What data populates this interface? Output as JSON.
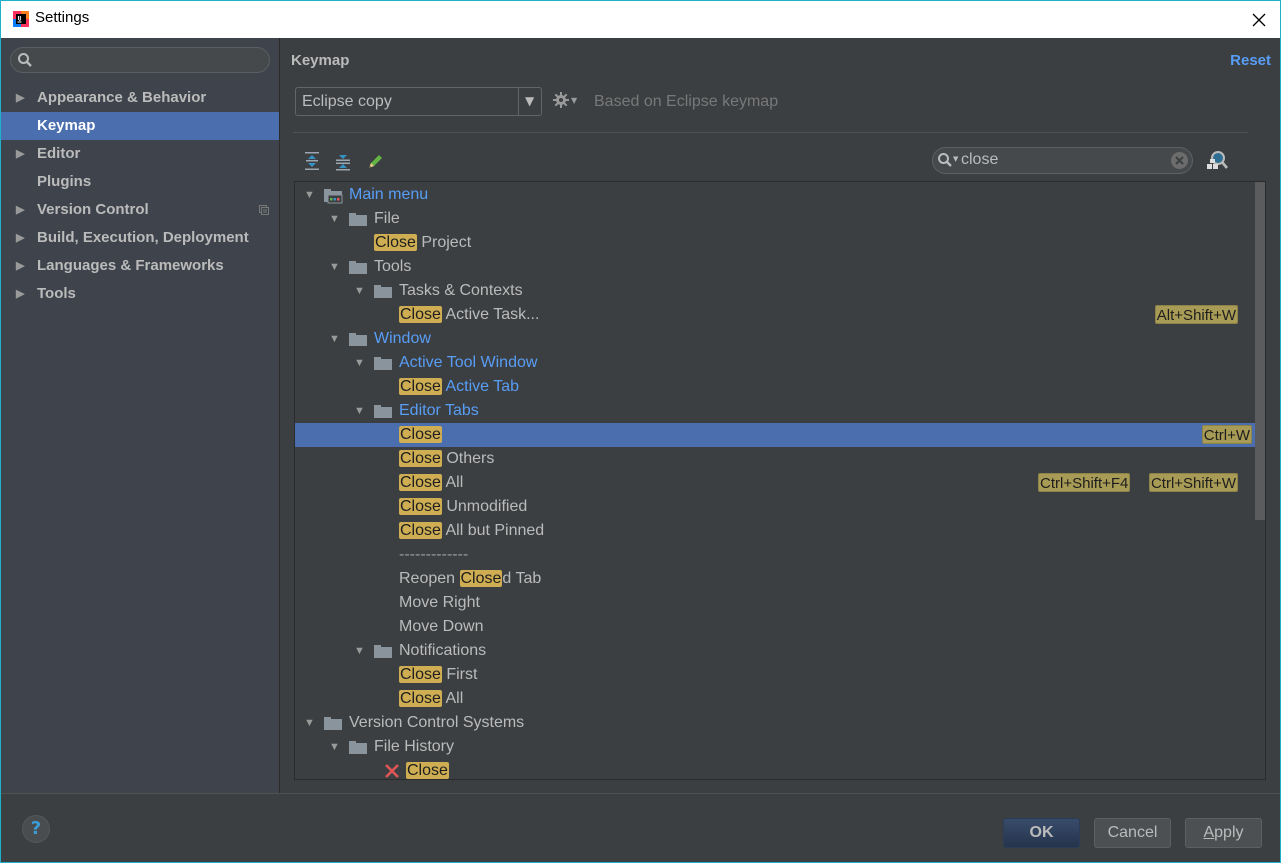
{
  "window": {
    "title": "Settings"
  },
  "sidebar": {
    "search_placeholder": "",
    "items": [
      {
        "label": "Appearance & Behavior",
        "expandable": true,
        "selected": false
      },
      {
        "label": "Keymap",
        "expandable": false,
        "selected": true
      },
      {
        "label": "Editor",
        "expandable": true,
        "selected": false
      },
      {
        "label": "Plugins",
        "expandable": false,
        "selected": false
      },
      {
        "label": "Version Control",
        "expandable": true,
        "selected": false,
        "project_icon": true
      },
      {
        "label": "Build, Execution, Deployment",
        "expandable": true,
        "selected": false
      },
      {
        "label": "Languages & Frameworks",
        "expandable": true,
        "selected": false
      },
      {
        "label": "Tools",
        "expandable": true,
        "selected": false
      }
    ]
  },
  "header": {
    "title": "Keymap",
    "reset_label": "Reset"
  },
  "keymap": {
    "selected": "Eclipse copy",
    "based_on": "Based on Eclipse keymap"
  },
  "toolbar": {
    "expand_all": "Expand All",
    "collapse_all": "Collapse All",
    "edit": "Edit Shortcut"
  },
  "filter": {
    "value": "close",
    "highlight": "Close"
  },
  "tree": {
    "rows": [
      {
        "level": 0,
        "type": "root",
        "expanded": true,
        "pre": "",
        "hl": "",
        "post": "Main menu",
        "blue": true,
        "shortcuts": []
      },
      {
        "level": 1,
        "type": "folder",
        "expanded": true,
        "pre": "",
        "hl": "",
        "post": "File",
        "blue": false,
        "shortcuts": []
      },
      {
        "level": 2,
        "type": "action",
        "pre": "",
        "hl": "Close",
        "post": " Project",
        "blue": false,
        "shortcuts": []
      },
      {
        "level": 1,
        "type": "folder",
        "expanded": true,
        "pre": "",
        "hl": "",
        "post": "Tools",
        "blue": false,
        "shortcuts": []
      },
      {
        "level": 2,
        "type": "folder",
        "expanded": true,
        "pre": "",
        "hl": "",
        "post": "Tasks & Contexts",
        "blue": false,
        "shortcuts": []
      },
      {
        "level": 3,
        "type": "action",
        "pre": "",
        "hl": "Close",
        "post": " Active Task...",
        "blue": false,
        "shortcuts": [
          "Alt+Shift+W"
        ]
      },
      {
        "level": 1,
        "type": "folder",
        "expanded": true,
        "pre": "",
        "hl": "",
        "post": "Window",
        "blue": true,
        "shortcuts": []
      },
      {
        "level": 2,
        "type": "folder",
        "expanded": true,
        "pre": "",
        "hl": "",
        "post": "Active Tool Window",
        "blue": true,
        "shortcuts": []
      },
      {
        "level": 3,
        "type": "action",
        "pre": "",
        "hl": "Close",
        "post": " Active Tab",
        "blue": true,
        "shortcuts": []
      },
      {
        "level": 2,
        "type": "folder",
        "expanded": true,
        "pre": "",
        "hl": "",
        "post": "Editor Tabs",
        "blue": true,
        "shortcuts": []
      },
      {
        "level": 3,
        "type": "action",
        "pre": "",
        "hl": "Close",
        "post": "",
        "blue": false,
        "selected": true,
        "shortcuts": [
          "Ctrl+W"
        ]
      },
      {
        "level": 3,
        "type": "action",
        "pre": "",
        "hl": "Close",
        "post": " Others",
        "blue": false,
        "shortcuts": []
      },
      {
        "level": 3,
        "type": "action",
        "pre": "",
        "hl": "Close",
        "post": " All",
        "blue": false,
        "shortcuts": [
          "Ctrl+Shift+F4",
          "Ctrl+Shift+W"
        ]
      },
      {
        "level": 3,
        "type": "action",
        "pre": "",
        "hl": "Close",
        "post": " Unmodified",
        "blue": false,
        "shortcuts": []
      },
      {
        "level": 3,
        "type": "action",
        "pre": "",
        "hl": "Close",
        "post": " All but Pinned",
        "blue": false,
        "shortcuts": []
      },
      {
        "level": 3,
        "type": "separator",
        "pre": "",
        "hl": "",
        "post": "-------------",
        "blue": false,
        "shortcuts": []
      },
      {
        "level": 3,
        "type": "action",
        "pre": "Reopen ",
        "hl": "Close",
        "post": "d Tab",
        "blue": false,
        "shortcuts": []
      },
      {
        "level": 3,
        "type": "action",
        "pre": "",
        "hl": "",
        "post": "Move Right",
        "blue": false,
        "shortcuts": []
      },
      {
        "level": 3,
        "type": "action",
        "pre": "",
        "hl": "",
        "post": "Move Down",
        "blue": false,
        "shortcuts": []
      },
      {
        "level": 2,
        "type": "folder",
        "expanded": true,
        "pre": "",
        "hl": "",
        "post": "Notifications",
        "blue": false,
        "shortcuts": []
      },
      {
        "level": 3,
        "type": "action",
        "pre": "",
        "hl": "Close",
        "post": " First",
        "blue": false,
        "shortcuts": []
      },
      {
        "level": 3,
        "type": "action",
        "pre": "",
        "hl": "Close",
        "post": " All",
        "blue": false,
        "shortcuts": []
      },
      {
        "level": 0,
        "type": "folder",
        "expanded": true,
        "pre": "",
        "hl": "",
        "post": "Version Control Systems",
        "blue": false,
        "shortcuts": []
      },
      {
        "level": 1,
        "type": "folder",
        "expanded": true,
        "pre": "",
        "hl": "",
        "post": "File History",
        "blue": false,
        "shortcuts": []
      },
      {
        "level": 2,
        "type": "action",
        "icon": "close-x-icon",
        "pre": "",
        "hl": "Close",
        "post": "",
        "blue": false,
        "shortcuts": []
      }
    ]
  },
  "buttons": {
    "ok": "OK",
    "cancel": "Cancel",
    "apply_mnemonic": "A",
    "apply_rest": "pply",
    "help": "?"
  },
  "colors": {
    "accent": "#589df6",
    "selection": "#4b6eaf",
    "highlight": "#cfae53",
    "shortcut_bg": "#a89b55",
    "window_border": "#1fb1c9"
  }
}
